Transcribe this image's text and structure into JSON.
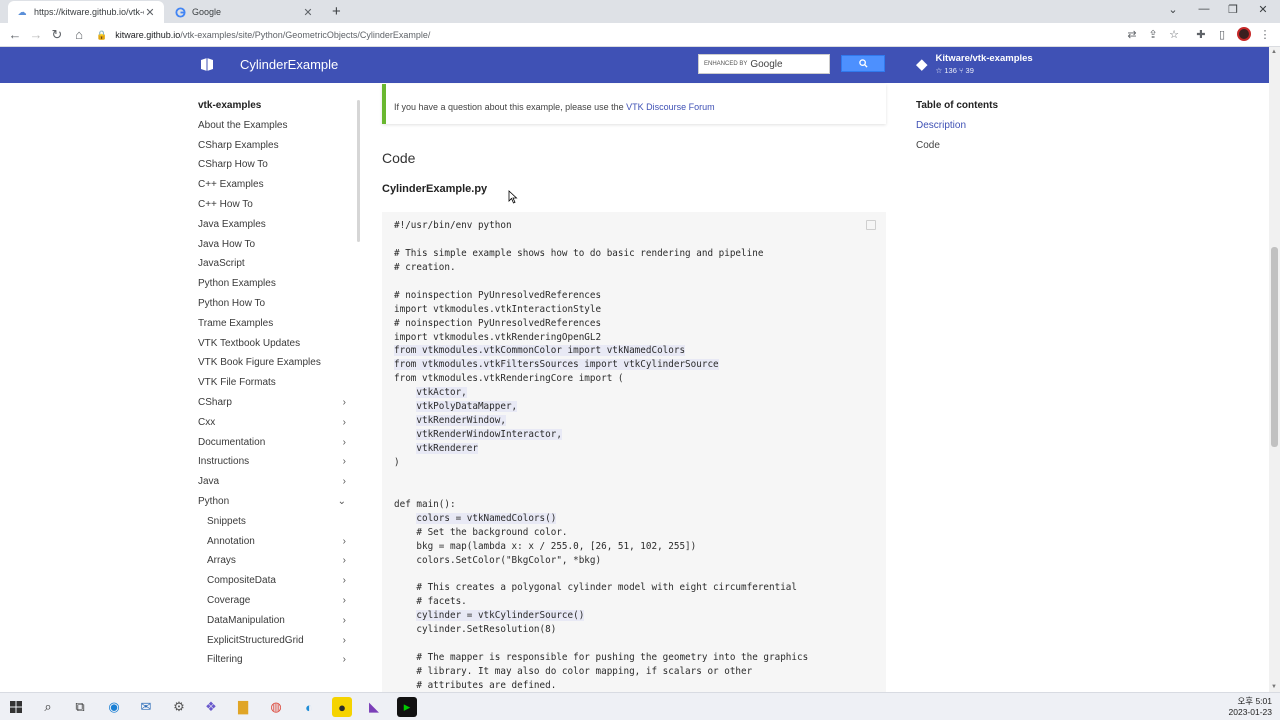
{
  "browser": {
    "tabs": [
      {
        "title": "https://kitware.github.io/vtk-exa",
        "active": true
      },
      {
        "title": "Google",
        "active": false
      }
    ],
    "url_host": "kitware.github.io",
    "url_path": "/vtk-examples/site/Python/GeometricObjects/CylinderExample/"
  },
  "header": {
    "title": "CylinderExample",
    "search_enhanced": "ENHANCED BY",
    "search_google": "Google",
    "repo_name": "Kitware/vtk-examples",
    "repo_stats": "☆ 136  ⑂ 39"
  },
  "nav": {
    "items": [
      {
        "label": "vtk-examples",
        "type": "heading"
      },
      {
        "label": "About the Examples"
      },
      {
        "label": "CSharp Examples"
      },
      {
        "label": "CSharp How To"
      },
      {
        "label": "C++ Examples"
      },
      {
        "label": "C++ How To"
      },
      {
        "label": "Java Examples"
      },
      {
        "label": "Java How To"
      },
      {
        "label": "JavaScript"
      },
      {
        "label": "Python Examples"
      },
      {
        "label": "Python How To"
      },
      {
        "label": "Trame Examples"
      },
      {
        "label": "VTK Textbook Updates"
      },
      {
        "label": "VTK Book Figure Examples"
      },
      {
        "label": "VTK File Formats"
      },
      {
        "label": "CSharp",
        "chev": "›"
      },
      {
        "label": "Cxx",
        "chev": "›"
      },
      {
        "label": "Documentation",
        "chev": "›"
      },
      {
        "label": "Instructions",
        "chev": "›"
      },
      {
        "label": "Java",
        "chev": "›"
      },
      {
        "label": "Python",
        "chev": "⌄"
      },
      {
        "label": "Snippets",
        "sub": true
      },
      {
        "label": "Annotation",
        "sub": true,
        "chev": "›"
      },
      {
        "label": "Arrays",
        "sub": true,
        "chev": "›"
      },
      {
        "label": "CompositeData",
        "sub": true,
        "chev": "›"
      },
      {
        "label": "Coverage",
        "sub": true,
        "chev": "›"
      },
      {
        "label": "DataManipulation",
        "sub": true,
        "chev": "›"
      },
      {
        "label": "ExplicitStructuredGrid",
        "sub": true,
        "chev": "›"
      },
      {
        "label": "Filtering",
        "sub": true,
        "chev": "›"
      }
    ]
  },
  "content": {
    "notice_text": "If you have a question about this example, please use the ",
    "notice_link": "VTK Discourse Forum",
    "section_title": "Code",
    "file_title": "CylinderExample.py",
    "code": [
      {
        "t": "#!/usr/bin/env python",
        "hl": false
      },
      {
        "t": "",
        "hl": false
      },
      {
        "t": "# This simple example shows how to do basic rendering and pipeline",
        "hl": false
      },
      {
        "t": "# creation.",
        "hl": false
      },
      {
        "t": "",
        "hl": false
      },
      {
        "t": "# noinspection PyUnresolvedReferences",
        "hl": false
      },
      {
        "t": "import vtkmodules.vtkInteractionStyle",
        "hl": false
      },
      {
        "t": "# noinspection PyUnresolvedReferences",
        "hl": false
      },
      {
        "t": "import vtkmodules.vtkRenderingOpenGL2",
        "hl": false
      },
      {
        "t": "from vtkmodules.vtkCommonColor import vtkNamedColors",
        "hl": true
      },
      {
        "t": "from vtkmodules.vtkFiltersSources import vtkCylinderSource",
        "hl": true
      },
      {
        "t": "from vtkmodules.vtkRenderingCore import (",
        "hl": false
      },
      {
        "t": "    vtkActor,",
        "hl": true
      },
      {
        "t": "    vtkPolyDataMapper,",
        "hl": true
      },
      {
        "t": "    vtkRenderWindow,",
        "hl": true
      },
      {
        "t": "    vtkRenderWindowInteractor,",
        "hl": true
      },
      {
        "t": "    vtkRenderer",
        "hl": true
      },
      {
        "t": ")",
        "hl": false
      },
      {
        "t": "",
        "hl": false
      },
      {
        "t": "",
        "hl": false
      },
      {
        "t": "def main():",
        "hl": false
      },
      {
        "t": "    colors = vtkNamedColors()",
        "hl": true
      },
      {
        "t": "    # Set the background color.",
        "hl": false
      },
      {
        "t": "    bkg = map(lambda x: x / 255.0, [26, 51, 102, 255])",
        "hl": false
      },
      {
        "t": "    colors.SetColor(\"BkgColor\", *bkg)",
        "hl": false
      },
      {
        "t": "",
        "hl": false
      },
      {
        "t": "    # This creates a polygonal cylinder model with eight circumferential",
        "hl": false
      },
      {
        "t": "    # facets.",
        "hl": false
      },
      {
        "t": "    cylinder = vtkCylinderSource()",
        "hl": true
      },
      {
        "t": "    cylinder.SetResolution(8)",
        "hl": false
      },
      {
        "t": "",
        "hl": false
      },
      {
        "t": "    # The mapper is responsible for pushing the geometry into the graphics",
        "hl": false
      },
      {
        "t": "    # library. It may also do color mapping, if scalars or other",
        "hl": false
      },
      {
        "t": "    # attributes are defined.",
        "hl": false
      }
    ]
  },
  "toc": {
    "title": "Table of contents",
    "items": [
      {
        "label": "Description",
        "active": true
      },
      {
        "label": "Code",
        "active": false
      }
    ]
  },
  "taskbar": {
    "time": "오후 5:01",
    "date": "2023-01-23"
  },
  "colors": {
    "header_bg": "#3f51b5",
    "notice_accent": "#69b72f",
    "link": "#3f51b5"
  }
}
